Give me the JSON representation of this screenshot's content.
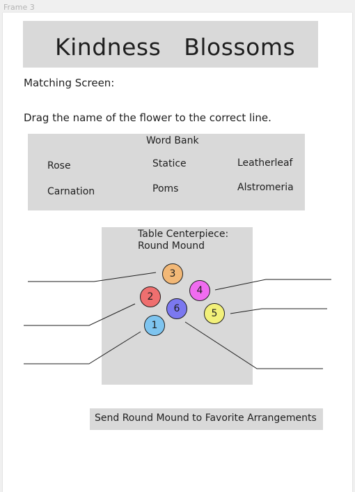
{
  "frame": {
    "label": "Frame 3"
  },
  "header": {
    "title": "Kindness   Blossoms"
  },
  "screen_label": "Matching Screen:",
  "instruction": "Drag the name of the flower to the correct line.",
  "word_bank": {
    "title": "Word Bank",
    "words": [
      "Rose",
      "Statice",
      "Leatherleaf",
      "Carnation",
      "Poms",
      "Alstromeria"
    ]
  },
  "centerpiece": {
    "title_line1": "Table Centerpiece:",
    "title_line2": "Round Mound"
  },
  "flowers": [
    {
      "number": "1",
      "color": "#7ec4ef"
    },
    {
      "number": "2",
      "color": "#ef6f6f"
    },
    {
      "number": "3",
      "color": "#f2b877"
    },
    {
      "number": "4",
      "color": "#f06cf0"
    },
    {
      "number": "5",
      "color": "#f2f07a"
    },
    {
      "number": "6",
      "color": "#7b78f0"
    }
  ],
  "send_button": {
    "label": "Send Round Mound to Favorite Arrangements"
  }
}
